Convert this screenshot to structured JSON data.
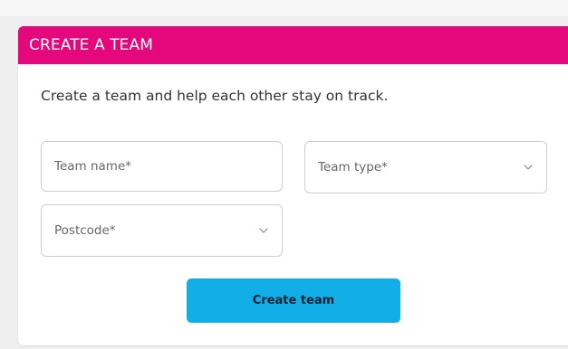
{
  "card": {
    "title": "CREATE A TEAM",
    "intro": "Create a team and help each other stay on track."
  },
  "form": {
    "team_name": {
      "placeholder": "Team name*",
      "value": ""
    },
    "team_type": {
      "label": "Team type*",
      "icon": "chevron-down-icon"
    },
    "postcode": {
      "label": "Postcode*",
      "icon": "chevron-down-icon"
    },
    "submit_label": "Create team"
  },
  "colors": {
    "header": "#e5087d",
    "button": "#12aee7"
  }
}
